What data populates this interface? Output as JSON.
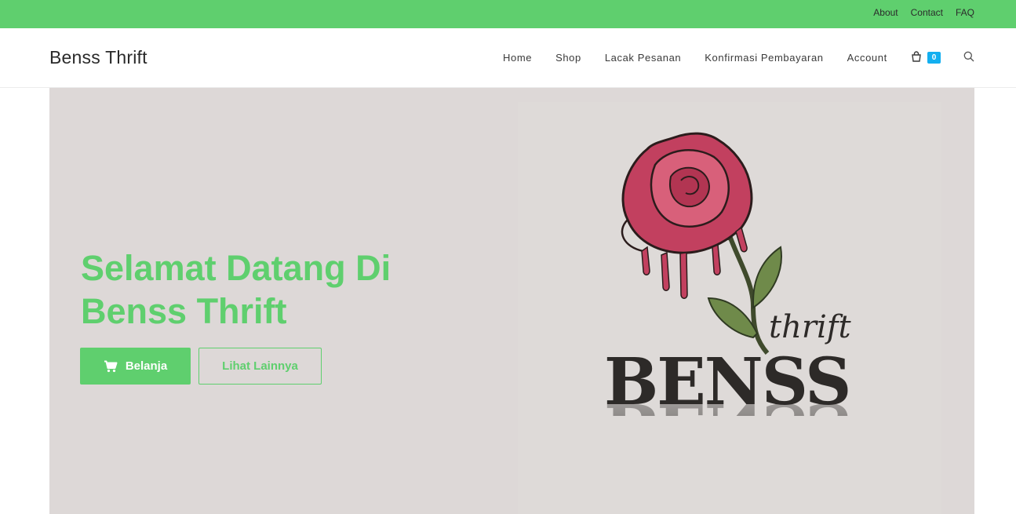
{
  "topbar": {
    "links": [
      "About",
      "Contact",
      "FAQ"
    ]
  },
  "header": {
    "brand": "Benss Thrift",
    "nav": [
      "Home",
      "Shop",
      "Lacak Pesanan",
      "Konfirmasi Pembayaran",
      "Account"
    ],
    "cart_count": "0"
  },
  "hero": {
    "title_line1": "Selamat Datang Di",
    "title_line2": "Benss Thrift",
    "primary_button": "Belanja",
    "secondary_button": "Lihat Lainnya"
  },
  "logo": {
    "script_word": "thrift",
    "brand_word": "BENSS"
  },
  "colors": {
    "accent": "#5fcf6e",
    "badge": "#13aff0",
    "hero_bg": "#ddd8d7"
  }
}
